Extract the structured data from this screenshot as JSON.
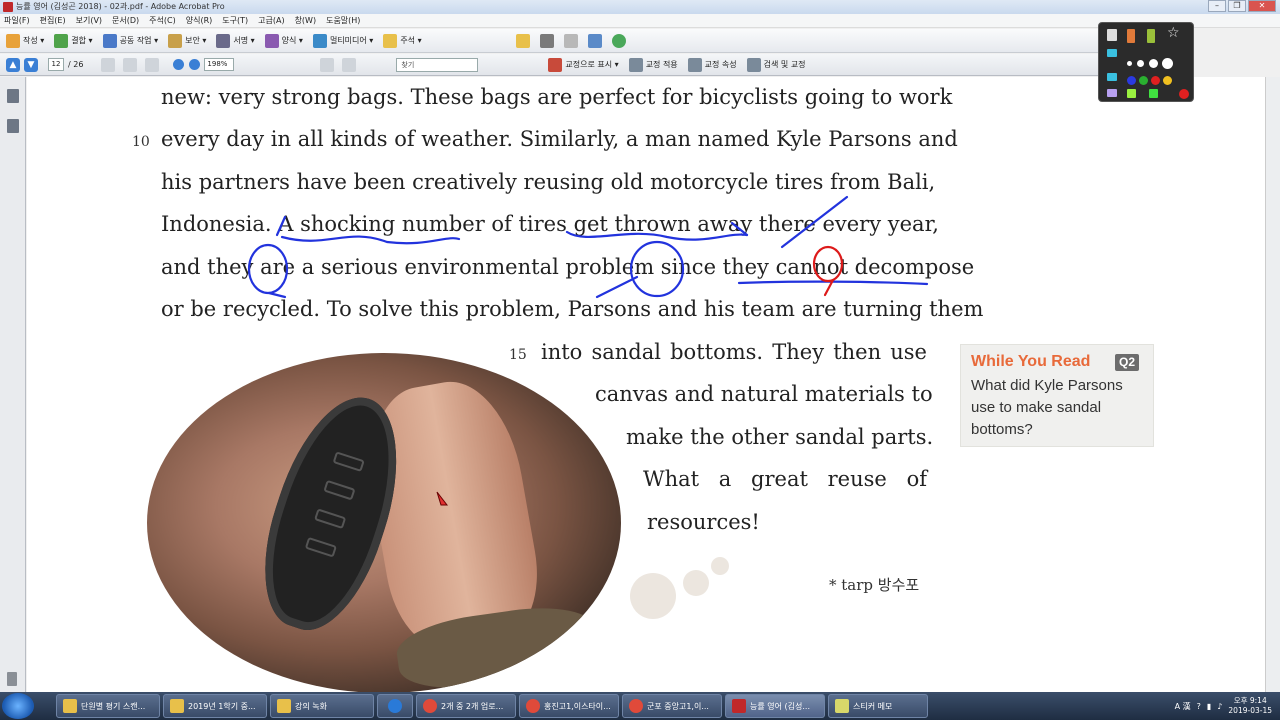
{
  "window": {
    "title": "능률 영어 (김성곤 2018) - 02과.pdf - Adobe Acrobat Pro"
  },
  "menu": [
    "파일(F)",
    "편집(E)",
    "보기(V)",
    "문서(D)",
    "주석(C)",
    "양식(R)",
    "도구(T)",
    "고급(A)",
    "창(W)",
    "도움말(H)"
  ],
  "toolbar1": [
    {
      "label": "작성 ▾",
      "color": "#e8a23a"
    },
    {
      "label": "결합 ▾",
      "color": "#4fa34a"
    },
    {
      "label": "공동 작업 ▾",
      "color": "#4a79c8"
    },
    {
      "label": "보안 ▾",
      "color": "#c8a04a"
    },
    {
      "label": "서명 ▾",
      "color": "#6a6a8a"
    },
    {
      "label": "양식 ▾",
      "color": "#8a5ab0"
    },
    {
      "label": "멀티미디어 ▾",
      "color": "#3a8ac8"
    },
    {
      "label": "주석 ▾",
      "color": "#e8c04a"
    }
  ],
  "toolbar2": {
    "current_page": "12",
    "total_pages": "/ 26",
    "zoom": "198%",
    "find_placeholder": "찾기",
    "actions": [
      "교정으로 표시 ▾",
      "교정 적용",
      "교정 속성",
      "검색 및 교정"
    ]
  },
  "document": {
    "lines": [
      "new: very strong bags. These bags are perfect for bicyclists going to work",
      "every day in all kinds of weather. Similarly, a man named Kyle Parsons and",
      "his partners have been creatively reusing old motorcycle tires from Bali,",
      "Indonesia. A shocking number of tires get thrown away there every year,",
      "and they are a serious environmental problem since they cannot decompose",
      "or be recycled. To solve this problem, Parsons and his team are turning them"
    ],
    "indented_lines": [
      "into sandal bottoms. They then use",
      "canvas and natural materials to",
      "make the other sandal parts.",
      "What a great reuse of",
      "resources!"
    ],
    "line_number_10": "10",
    "line_number_15": "15",
    "footnote": "* tarp 방수포"
  },
  "while_you_read": {
    "title": "While You Read",
    "badge": "Q2",
    "question": "What did Kyle Parsons use to make sandal bottoms?"
  },
  "taskbar": {
    "tasks": [
      {
        "label": "단원별 평기 스캔...",
        "color": "#e8c04a"
      },
      {
        "label": "2019년 1학기 중...",
        "color": "#e8c04a"
      },
      {
        "label": "강의 녹화",
        "color": "#e8c04a"
      },
      {
        "label": "",
        "color": "#2a7ad8"
      },
      {
        "label": "2개 중 2개 업로...",
        "color": "#e04a3a"
      },
      {
        "label": "홍진고1,이스타이...",
        "color": "#e04a3a"
      },
      {
        "label": "군포 중앙고1,이...",
        "color": "#e04a3a"
      },
      {
        "label": "능률 영어 (김성...",
        "color": "#c0282a"
      },
      {
        "label": "스티커 메모",
        "color": "#d8d86a"
      }
    ],
    "ime": "A 漢",
    "time": "오후 9:14",
    "date": "2019-03-15"
  }
}
